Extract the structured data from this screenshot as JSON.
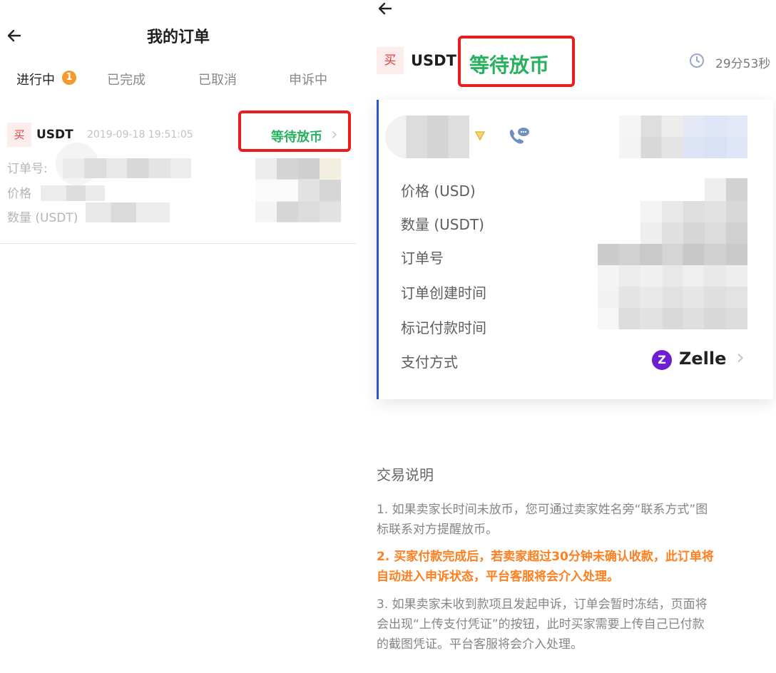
{
  "left": {
    "title": "我的订单",
    "tabs": [
      {
        "label": "进行中",
        "badge": "1"
      },
      {
        "label": "已完成"
      },
      {
        "label": "已取消"
      },
      {
        "label": "申诉中"
      }
    ],
    "order": {
      "side": "买",
      "coin": "USDT",
      "time": "2019-09-18 19:51:05",
      "status": "等待放币",
      "fields": [
        "订单号:",
        "价格",
        "数量 (USDT)"
      ]
    }
  },
  "right": {
    "side": "买",
    "coin": "USDT",
    "status": "等待放币",
    "countdown": "29分53秒",
    "details": [
      {
        "label": "价格 (USD)"
      },
      {
        "label": "数量 (USDT)"
      },
      {
        "label": "订单号"
      },
      {
        "label": "订单创建时间"
      },
      {
        "label": "标记付款时间"
      },
      {
        "label": "支付方式",
        "value": "Zelle"
      }
    ],
    "notes_title": "交易说明",
    "notes": [
      {
        "line1": "1. 如果卖家长时间未放币，您可通过卖家姓名旁“联系方式”图",
        "line2": "标联系对方提醒放币。"
      },
      {
        "line1": "2. 买家付款完成后，若卖家超过30分钟未确认收款，此订单将",
        "line2": "自动进入申诉状态，平台客服将会介入处理。"
      },
      {
        "line1": "3. 如果卖家未收到款项且发起申诉，订单会暂时冻结，页面将",
        "line2": "会出现“上传支付凭证”的按钮，此时买家需要上传自己已付款",
        "line3": "的截图凭证。平台客服将会介入处理。"
      }
    ]
  },
  "colors": {
    "status_green": "#27b15e",
    "highlight_red": "#ec1c1c",
    "badge_orange": "#f29a2b",
    "warning_orange": "#ff7f1f",
    "buy_red": "#e43b3b",
    "card_accent_blue": "#3056d3",
    "zelle_purple": "#6d1ed4"
  },
  "icons": [
    "back-arrow-icon",
    "chevron-right-icon",
    "clock-icon",
    "verified-badge-icon",
    "phone-chat-icon",
    "zelle-logo-icon"
  ]
}
